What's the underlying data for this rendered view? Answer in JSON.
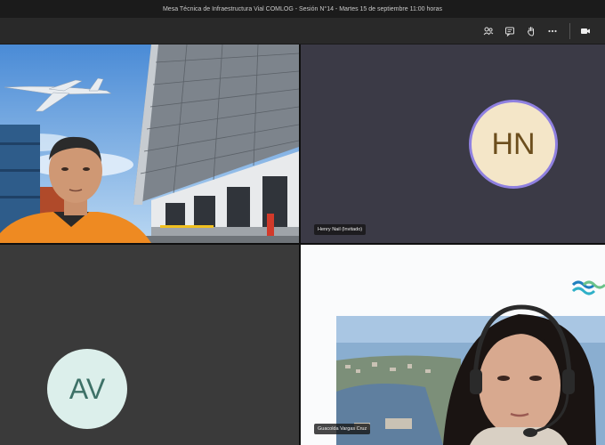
{
  "window": {
    "title": "Mesa Técnica de Infraestructura Vial COMLOG - Sesión N°14 - Martes 15 de septiembre 11:00 horas"
  },
  "toolbar": {
    "icons": [
      "participants-icon",
      "chat-icon",
      "raise-hand-icon",
      "more-options-icon",
      "camera-icon"
    ]
  },
  "participants": [
    {
      "kind": "video",
      "description_icon": "warehouse-background-video"
    },
    {
      "kind": "avatar",
      "initials": "HN",
      "name": "Henry Nail (Invitado)",
      "avatar_bg": "#f4e6c8",
      "avatar_fg": "#6c4e1d",
      "ring": "#8f80e0"
    },
    {
      "kind": "avatar",
      "initials": "AV",
      "avatar_bg": "#dcefeb",
      "avatar_fg": "#3d7167"
    },
    {
      "kind": "video",
      "name": "Guacolda Vargas Cruz"
    }
  ]
}
